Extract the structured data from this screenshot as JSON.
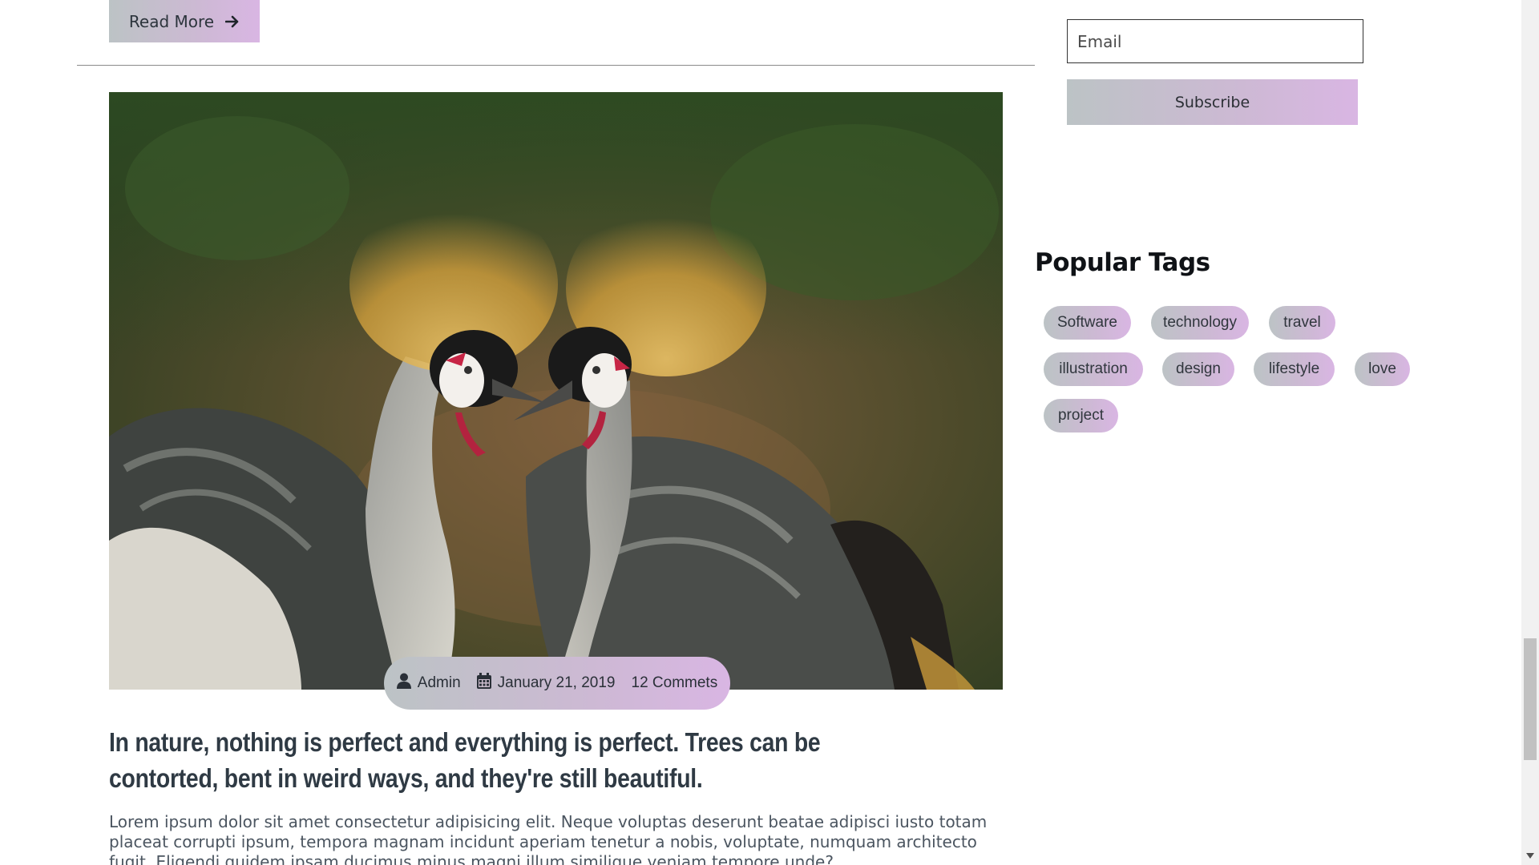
{
  "post_prev": {
    "read_more_label": "Read More",
    "arrow_icon": "arrow-right-icon"
  },
  "post": {
    "image": {
      "subject": "crowned-cranes-photo"
    },
    "meta": {
      "author": "Admin",
      "date": "January 21, 2019",
      "comments": "12 Commets",
      "author_icon": "user-icon",
      "date_icon": "calendar-icon"
    },
    "title": "In nature, nothing is perfect and everything is perfect. Trees can be contorted, bent in weird ways, and they're still beautiful.",
    "excerpt": "Lorem ipsum dolor sit amet consectetur adipisicing elit. Neque voluptas deserunt beatae adipisci iusto totam placeat corrupti ipsum, tempora magnam incidunt aperiam tenetur a nobis, voluptate, numquam architecto fugit. Eligendi quidem ipsam ducimus minus magni illum similique veniam tempore unde?"
  },
  "sidebar": {
    "newsletter": {
      "email_placeholder": "Email",
      "subscribe_label": "Subscribe"
    },
    "popular_tags": {
      "heading": "Popular Tags",
      "tags": [
        "Software",
        "technology",
        "travel",
        "illustration",
        "design",
        "lifestyle",
        "love",
        "project"
      ]
    }
  },
  "colors": {
    "gradient_start": "#bcc3c5",
    "gradient_end": "#d9b6e3",
    "title_text": "#2f3a44",
    "body_text": "#4b5560"
  }
}
